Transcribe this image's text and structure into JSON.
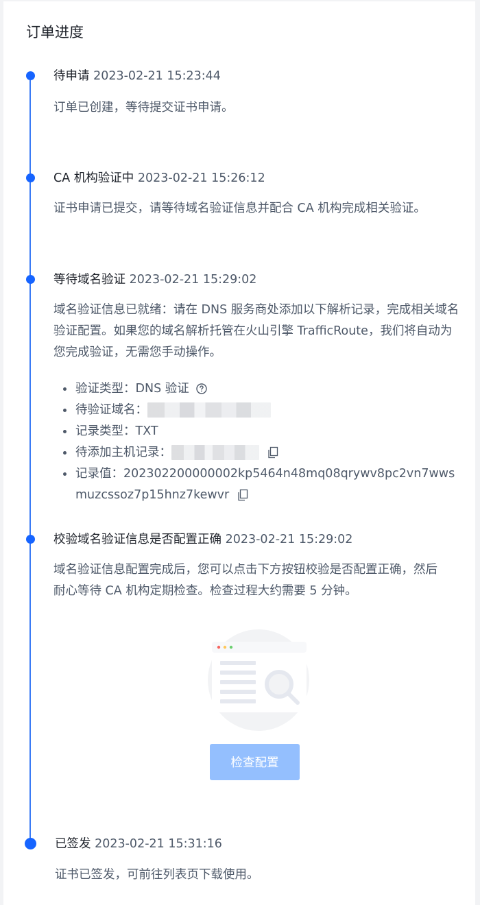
{
  "page_title": "订单进度",
  "steps": [
    {
      "status": "待申请",
      "time": "2023-02-21 15:23:44",
      "desc": "订单已创建，等待提交证书申请。"
    },
    {
      "status": "CA 机构验证中",
      "time": "2023-02-21 15:26:12",
      "desc": "证书申请已提交，请等待域名验证信息并配合 CA 机构完成相关验证。"
    },
    {
      "status": "等待域名验证",
      "time": "2023-02-21 15:29:02",
      "desc": "域名验证信息已就绪：请在 DNS 服务商处添加以下解析记录，完成相关域名验证配置。如果您的域名解析托管在火山引擎 TrafficRoute，我们将自动为您完成验证，无需您手动操作。",
      "details": {
        "verify_type_label": "验证类型：",
        "verify_type_value": "DNS 验证",
        "domain_label": "待验证域名：",
        "record_type_label": "记录类型：",
        "record_type_value": "TXT",
        "host_label": "待添加主机记录：",
        "record_value_label": "记录值：",
        "record_value": "202302200000002kp5464n48mq08qrywv8pc2vn7wwsmuzcssoz7p15hnz7kewvr"
      }
    },
    {
      "status": "校验域名验证信息是否配置正确",
      "time": "2023-02-21 15:29:02",
      "desc": "域名验证信息配置完成后，您可以点击下方按钮校验是否配置正确，然后耐心等待 CA 机构定期检查。检查过程大约需要 5 分钟。",
      "button_label": "检查配置"
    },
    {
      "status": "已签发",
      "time": "2023-02-21 15:31:16",
      "desc": "证书已签发，可前往列表页下载使用。"
    }
  ],
  "colors": {
    "timeline_dot": "#1664ff",
    "timeline_line": "#3a7bf5",
    "button_disabled": "#94bffe"
  }
}
